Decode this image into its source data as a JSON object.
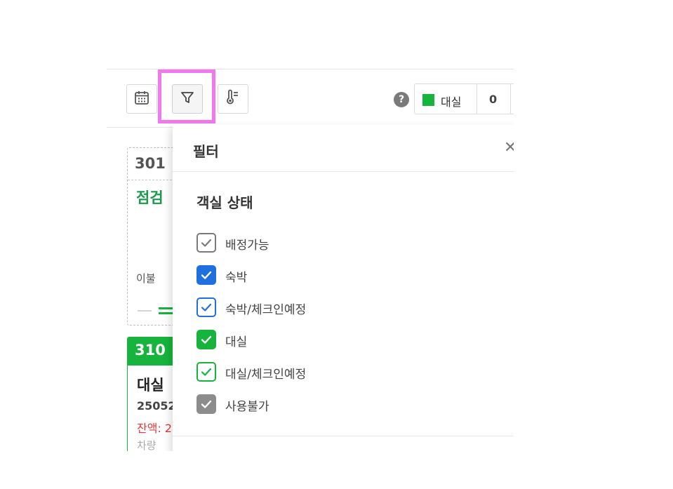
{
  "toolbar": {
    "buttons": [
      {
        "icon": "calendar-icon"
      },
      {
        "icon": "filter-icon"
      },
      {
        "icon": "thermometer-icon"
      }
    ],
    "help_label": "?",
    "legend": {
      "label": "대실",
      "count": "0",
      "color": "#16b43c"
    }
  },
  "rooms": [
    {
      "number": "301",
      "status": "점검",
      "note": "이불 ",
      "style": "dashed"
    },
    {
      "number": "310",
      "status": "대실",
      "code": "25052",
      "balance": "잔액: 2",
      "sub": "차량",
      "color": "#16b43c"
    }
  ],
  "filter_panel": {
    "title": "필터",
    "close_label": "✕",
    "section_title": "객실 상태",
    "options": [
      {
        "label": "배정가능",
        "checked": true,
        "style": "outline-gray"
      },
      {
        "label": "숙박",
        "checked": true,
        "style": "solid-blue"
      },
      {
        "label": "숙박/체크인예정",
        "checked": true,
        "style": "outline-blue"
      },
      {
        "label": "대실",
        "checked": true,
        "style": "solid-green"
      },
      {
        "label": "대실/체크인예정",
        "checked": true,
        "style": "outline-green"
      },
      {
        "label": "사용불가",
        "checked": true,
        "style": "solid-gray"
      }
    ]
  },
  "colors": {
    "green": "#16b43c",
    "blue": "#1f6fe0",
    "highlight": "#f178ee",
    "red": "#e23a3a"
  }
}
